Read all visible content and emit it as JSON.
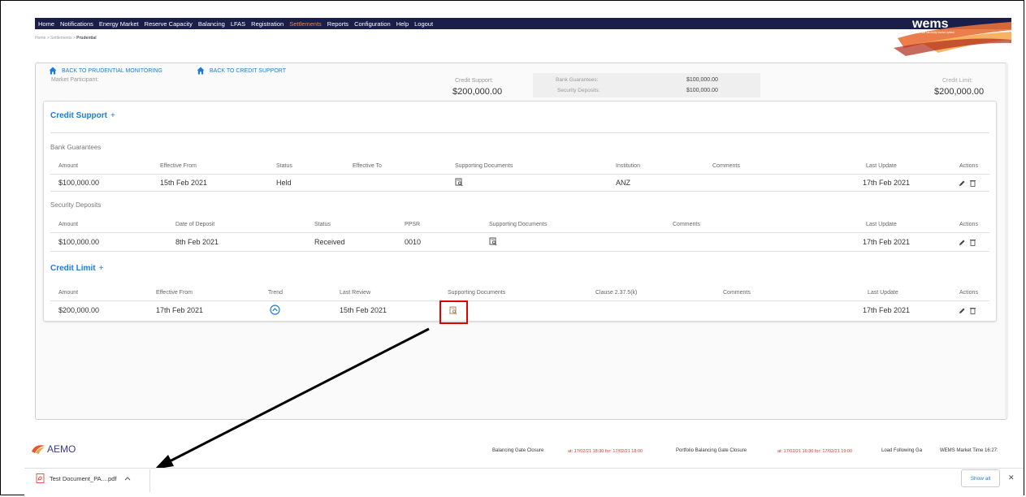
{
  "nav": {
    "items": [
      "Home",
      "Notifications",
      "Energy Market",
      "Reserve Capacity",
      "Balancing",
      "LFAS",
      "Registration",
      "Settlements",
      "Reports",
      "Configuration",
      "Help",
      "Logout"
    ],
    "active_index": 7,
    "logo_text": "wems",
    "logo_subtext": "wholesale electricity market system"
  },
  "breadcrumb": {
    "home": "Home",
    "settlements": "Settlements",
    "current": "Prudential",
    "sep": ">"
  },
  "header": {
    "back_prudential": "BACK TO PRUDENTIAL MONITORING",
    "back_credit": "BACK TO CREDIT SUPPORT",
    "market_participant_label": "Market Participant:",
    "credit_support_label": "Credit Support:",
    "credit_support_value": "$200,000.00",
    "bank_guarantees_label": "Bank Guarantees:",
    "bank_guarantees_value": "$100,000.00",
    "security_deposits_label": "Security Deposits:",
    "security_deposits_value": "$100,000.00",
    "credit_limit_label": "Credit Limit:",
    "credit_limit_value": "$200,000.00"
  },
  "credit_support": {
    "title": "Credit Support",
    "plus": "+",
    "bank_guarantees": {
      "title": "Bank Guarantees",
      "headers": [
        "Amount",
        "Effective From",
        "Status",
        "Effective To",
        "Supporting Documents",
        "Institution",
        "Comments",
        "Last Update",
        "Actions"
      ],
      "row": {
        "amount": "$100,000.00",
        "effective_from": "15th Feb 2021",
        "status": "Held",
        "effective_to": "",
        "institution": "ANZ",
        "comments": "",
        "last_update": "17th Feb 2021"
      }
    },
    "security_deposits": {
      "title": "Security Deposits",
      "headers": [
        "Amount",
        "Date of Deposit",
        "Status",
        "PPSR",
        "Supporting Documents",
        "Comments",
        "Last Update",
        "Actions"
      ],
      "row": {
        "amount": "$100,000.00",
        "date_of_deposit": "8th Feb 2021",
        "status": "Received",
        "ppsr": "0010",
        "comments": "",
        "last_update": "17th Feb 2021"
      }
    }
  },
  "credit_limit": {
    "title": "Credit Limit",
    "plus": "+",
    "headers": [
      "Amount",
      "Effective From",
      "Trend",
      "Last Review",
      "Supporting Documents",
      "Clause 2.37.5(k)",
      "Comments",
      "Last Update",
      "Actions"
    ],
    "row": {
      "amount": "$200,000.00",
      "effective_from": "17th Feb 2021",
      "last_review": "15th Feb 2021",
      "clause": "",
      "comments": "",
      "last_update": "17th Feb 2021"
    }
  },
  "footer": {
    "aemo": "AEMO",
    "balancing_gate_label": "Balancing Gate Closure",
    "balancing_gate_value": "at: 17/02/21 18:30 for: 17/02/21 18:00",
    "portfolio_gate_label": "Portfolio Balancing Gate Closure",
    "portfolio_gate_value": "at: 17/02/21 16:30 for: 17/02/21 19:00",
    "load_following_label": "Load Following Ga",
    "market_time_label": "WEMS Market Time 16:27:"
  },
  "download_bar": {
    "file_name": "Test Document_PA....pdf",
    "show_all": "Show all",
    "close": "✕"
  },
  "colors": {
    "nav_bg": "#1a1f4a",
    "nav_active": "#f0883a",
    "accent": "#1e7bd8",
    "highlight": "#e00000"
  }
}
